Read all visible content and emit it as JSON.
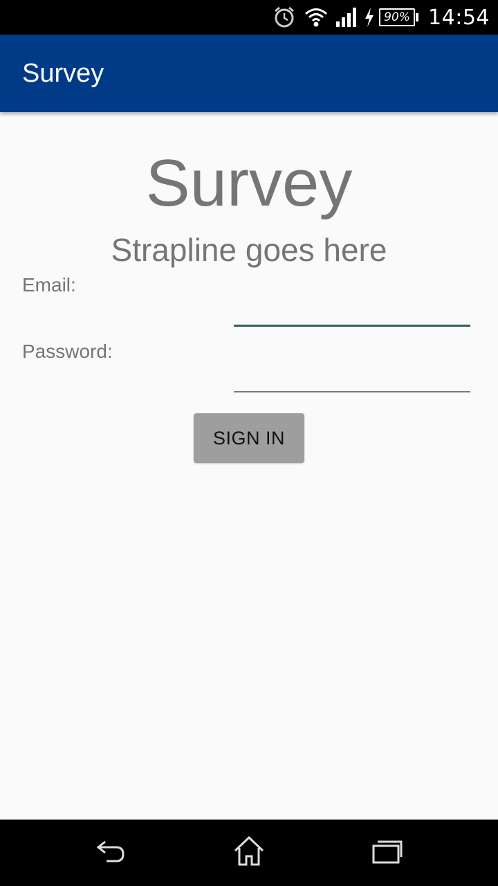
{
  "status_bar": {
    "battery_percent": "90%",
    "time": "14:54",
    "icons": [
      "alarm-icon",
      "wifi-icon",
      "signal-icon",
      "charging-icon",
      "battery-icon"
    ]
  },
  "app_bar": {
    "title": "Survey",
    "color": "#013b87"
  },
  "main": {
    "title": "Survey",
    "strapline": "Strapline goes here",
    "email": {
      "label": "Email:",
      "value": "",
      "placeholder": ""
    },
    "password": {
      "label": "Password:",
      "value": "",
      "placeholder": ""
    },
    "sign_in_label": "SIGN IN"
  },
  "nav_bar": {
    "icons": [
      "back-icon",
      "home-icon",
      "recents-icon"
    ]
  }
}
